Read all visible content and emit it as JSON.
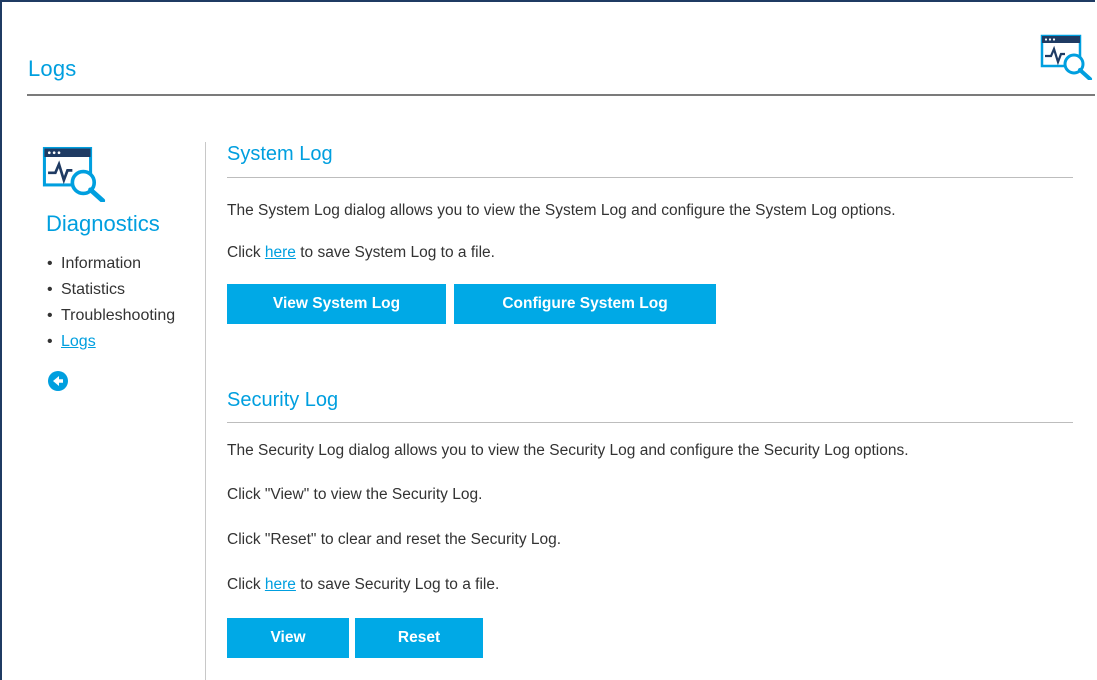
{
  "page": {
    "title": "Logs"
  },
  "sidebar": {
    "title": "Diagnostics",
    "items": [
      {
        "label": "Information",
        "active": false
      },
      {
        "label": "Statistics",
        "active": false
      },
      {
        "label": "Troubleshooting",
        "active": false
      },
      {
        "label": "Logs",
        "active": true
      }
    ],
    "back_icon": "back-arrow-icon"
  },
  "system_log": {
    "heading": "System Log",
    "description": "The System Log dialog allows you to view the System Log and configure the System Log options.",
    "save_prefix": "Click ",
    "save_link": "here",
    "save_suffix": " to save System Log to a file.",
    "view_button": "View System Log",
    "configure_button": "Configure System Log"
  },
  "security_log": {
    "heading": "Security Log",
    "description": "The Security Log dialog allows you to view the Security Log and configure the Security Log options.",
    "view_hint": "Click \"View\" to view the Security Log.",
    "reset_hint": "Click \"Reset\" to clear and reset the Security Log.",
    "save_prefix": "Click ",
    "save_link": "here",
    "save_suffix": " to save Security Log to a file.",
    "view_button": "View",
    "reset_button": "Reset"
  },
  "colors": {
    "accent": "#009fdf",
    "button": "#00a9e6",
    "icon_dark": "#1f3b63"
  },
  "icons": [
    "diagnostics-icon",
    "back-arrow-icon"
  ]
}
